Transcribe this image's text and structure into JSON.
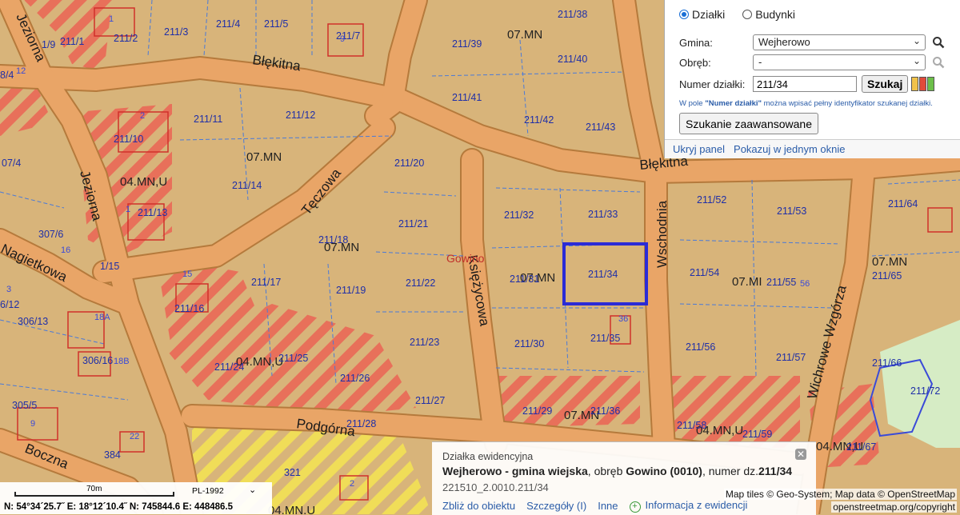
{
  "colors": {
    "base": "#d8b47a",
    "road": "#e9a567",
    "road_edge": "#b57a3c",
    "stripe_red": "#e8705a",
    "green": "#d6ecc5",
    "selection": "#2b2bd6",
    "label": "#1f2fa8",
    "zone_label": "#222222"
  },
  "map": {
    "streets": [
      "Jeziorna",
      "Błękitna",
      "Tęczowa",
      "Nagietkowa",
      "Księżycowa",
      "Wschodnia",
      "Wichrowe Wzgórza",
      "Podgórna",
      "Boczna",
      "Jeziorna",
      "Błękitna"
    ],
    "zones": [
      "07.MN",
      "07.MN",
      "04.MN,U",
      "07.MN",
      "07.MN",
      "07.MN",
      "07.MI",
      "07.MN",
      "04.MN,U",
      "04.MN,U",
      "04.MN,U",
      "04.MN,U"
    ],
    "place": "Gowino",
    "parcels": [
      "211/1",
      "211/2",
      "211/3",
      "211/4",
      "211/5",
      "211/7",
      "211/38",
      "211/39",
      "211/40",
      "211/41",
      "211/42",
      "211/43",
      "211/10",
      "211/11",
      "211/12",
      "211/13",
      "211/14",
      "211/20",
      "211/21",
      "211/18",
      "211/22",
      "211/17",
      "211/19",
      "211/16",
      "211/23",
      "211/24",
      "211/25",
      "211/26",
      "211/27",
      "211/28",
      "211/32",
      "211/33",
      "211/31",
      "211/34",
      "211/30",
      "211/35",
      "211/29",
      "211/36",
      "211/52",
      "211/53",
      "211/64",
      "211/54",
      "211/55",
      "211/65",
      "211/56",
      "211/57",
      "211/66",
      "211/72",
      "211/58",
      "211/59",
      "211/67",
      "307/6",
      "1/15",
      "6/12",
      "306/13",
      "306/16",
      "305/5",
      "384",
      "321",
      "07/4",
      "1/9",
      "8/4"
    ],
    "house_numbers": [
      "1",
      "9",
      "2",
      "1",
      "16",
      "15",
      "3",
      "18A",
      "18B",
      "9",
      "22",
      "36",
      "56",
      "2",
      "12"
    ]
  },
  "panel": {
    "radio_parcels": "Działki",
    "radio_buildings": "Budynki",
    "gmina_label": "Gmina:",
    "gmina_value": "Wejherowo",
    "obreb_label": "Obręb:",
    "obreb_value": "-",
    "numer_label": "Numer działki:",
    "numer_value": "211/34",
    "search_button": "Szukaj",
    "hint_prefix": "W pole ",
    "hint_field": "\"Numer działki\"",
    "hint_suffix": " można wpisać pełny identyfikator szukanej działki.",
    "advanced_button": "Szukanie zaawansowane",
    "hide_panel": "Ukryj panel",
    "show_single": "Pokazuj w jednym oknie",
    "swatch_colors": [
      "#f0c24a",
      "#e14a3a",
      "#6cbf4a"
    ]
  },
  "info": {
    "title": "Działka ewidencyjna",
    "gmina": "Wejherowo - gmina wiejska",
    "obreb_prefix": ", obręb ",
    "obreb": "Gowino (0010)",
    "numer_prefix": ", numer dz.",
    "numer": "211/34",
    "identifier": "221510_2.0010.211/34",
    "zoom_link": "Zbliż do obiektu",
    "details_link": "Szczegóły (I)",
    "other_link": "Inne",
    "register_link": "Informacja z ewidencji"
  },
  "scale": {
    "label": "70m",
    "projection": "PL-1992",
    "coords": "N: 54°34´25.7˝  E: 18°12´10.4˝  N: 745844.6  E: 448486.5"
  },
  "attribution": {
    "tiles": "Map tiles © Geo-System; Map data © OpenStreetMap",
    "url": "openstreetmap.org/copyright"
  }
}
